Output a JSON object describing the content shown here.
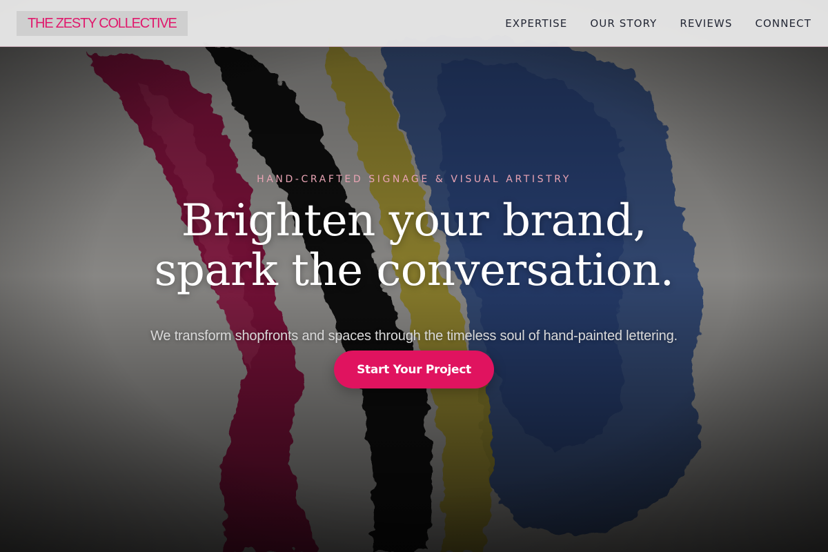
{
  "brand": {
    "name": "THE ZESTY COLLECTIVE",
    "accent_color": "#e0186c"
  },
  "nav": {
    "items": [
      {
        "label": "EXPERTISE"
      },
      {
        "label": "OUR STORY"
      },
      {
        "label": "REVIEWS"
      },
      {
        "label": "CONNECT"
      }
    ]
  },
  "hero": {
    "eyebrow": "HAND-CRAFTED SIGNAGE & VISUAL ARTISTRY",
    "headline_line1": "Brighten your brand,",
    "headline_line2": "spark the conversation.",
    "subheadline": "We transform shopfronts and spaces through the timeless soul of hand-painted lettering.",
    "cta_label": "Start Your Project",
    "cta_color": "#e0135f",
    "background_image": "abstract-paint-strokes-image"
  }
}
